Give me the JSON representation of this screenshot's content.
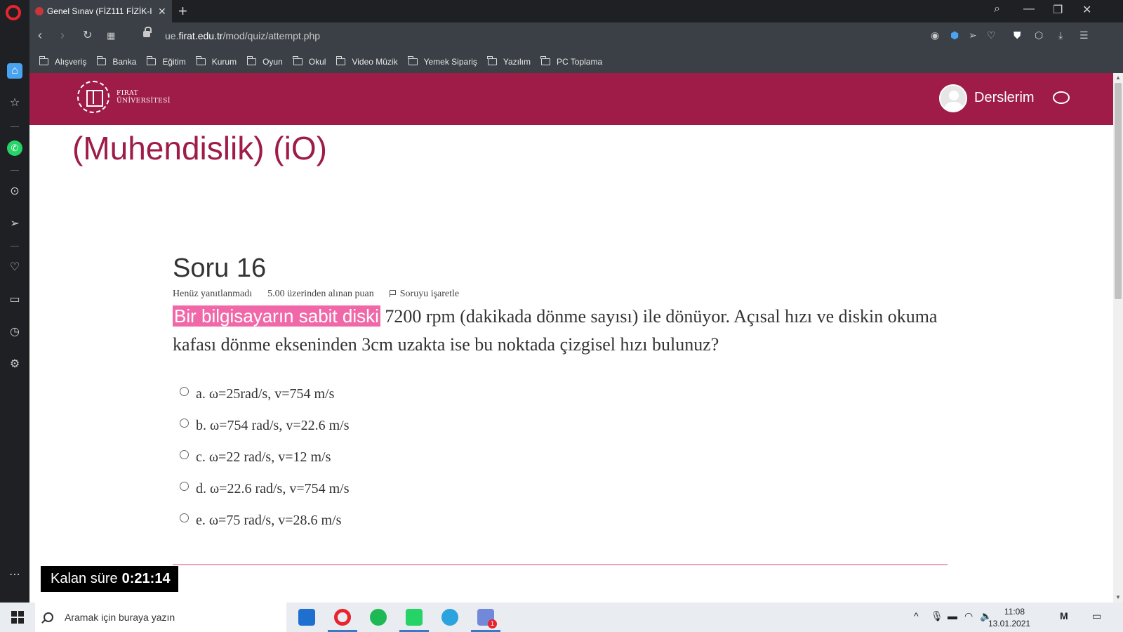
{
  "browser": {
    "tab_title": "Genel Sınav (FİZ111 FİZİK-I",
    "tab_close": "✕",
    "new_tab": "+",
    "url_prefix": "ue.",
    "url_domain": "firat.edu.tr",
    "url_path": "/mod/quiz/attempt.php",
    "bookmarks": [
      "Alışveriş",
      "Banka",
      "Eğitim",
      "Kurum",
      "Oyun",
      "Okul",
      "Video Müzik",
      "Yemek Sipariş",
      "Yazılım",
      "PC Toplama"
    ]
  },
  "site": {
    "logo_line1": "FIRAT",
    "logo_line2": "ÜNİVERSİTESİ",
    "nav_label": "Derslerim",
    "course_title": "(Muhendislik) (iO)"
  },
  "question": {
    "title": "Soru 16",
    "status": "Henüz yanıtlanmadı",
    "points": "5.00 üzerinden alınan puan",
    "flag_label": "Soruyu işaretle",
    "text_highlight": "Bir bilgisayarın sabit diski",
    "text_rest": " 7200 rpm (dakikada dönme sayısı) ile dönüyor. Açısal hızı ve diskin okuma kafası dönme ekseninden 3cm uzakta ise bu noktada çizgisel hızı bulunuz?",
    "answers": [
      "a. ω=25rad/s, v=754 m/s",
      "b. ω=754 rad/s, v=22.6 m/s",
      "c. ω=22 rad/s, v=12 m/s",
      "d. ω=22.6 rad/s,  v=754 m/s",
      "e. ω=75 rad/s, v=28.6 m/s"
    ]
  },
  "timer": {
    "label": "Kalan süre",
    "value": "0:21:14"
  },
  "taskbar": {
    "search_placeholder": "Aramak için buraya yazın",
    "time": "11:08",
    "date": "13.01.2021",
    "notification_count": "1"
  }
}
